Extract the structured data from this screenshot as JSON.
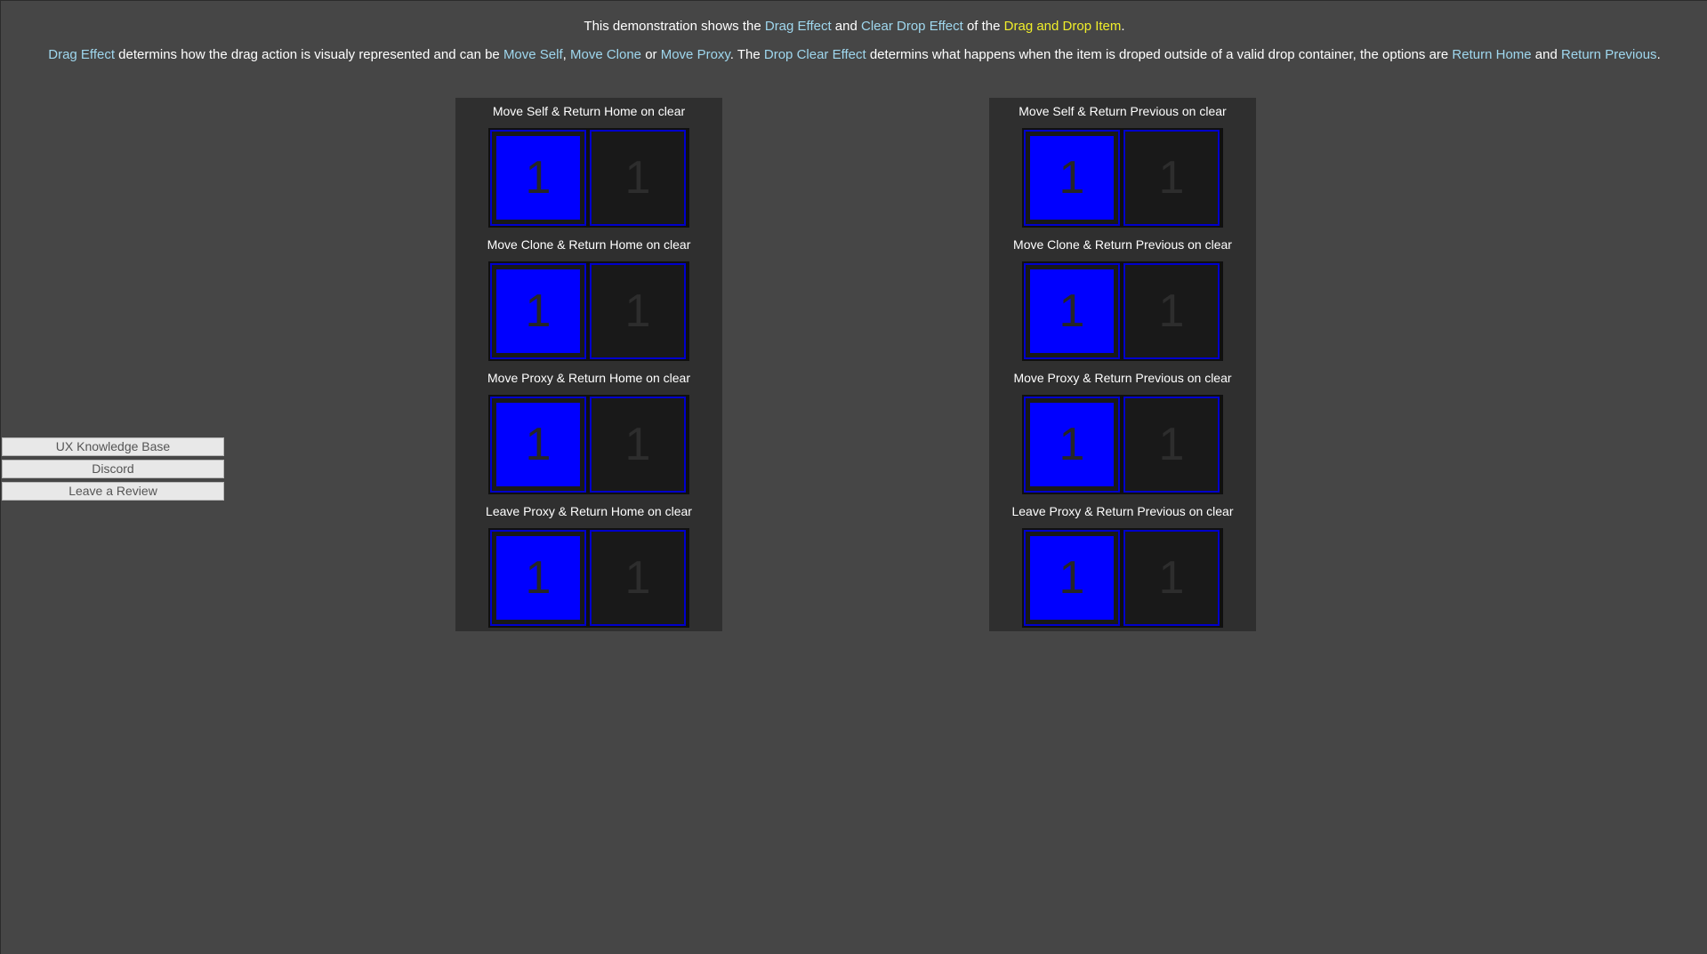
{
  "intro": {
    "line1": [
      {
        "text": "This demonstration shows the ",
        "style": "plain"
      },
      {
        "text": "Drag Effect",
        "style": "hl"
      },
      {
        "text": " and ",
        "style": "plain"
      },
      {
        "text": "Clear Drop Effect",
        "style": "hl"
      },
      {
        "text": " of the ",
        "style": "plain"
      },
      {
        "text": "Drag and Drop Item",
        "style": "hly"
      },
      {
        "text": ".",
        "style": "plain"
      }
    ],
    "line2": [
      {
        "text": "Drag Effect",
        "style": "hl"
      },
      {
        "text": " determins how the drag action is visualy represented and can be ",
        "style": "plain"
      },
      {
        "text": "Move Self",
        "style": "hl"
      },
      {
        "text": ", ",
        "style": "plain"
      },
      {
        "text": "Move Clone",
        "style": "hl"
      },
      {
        "text": " or ",
        "style": "plain"
      },
      {
        "text": "Move Proxy",
        "style": "hl"
      },
      {
        "text": ". The ",
        "style": "plain"
      },
      {
        "text": "Drop Clear Effect",
        "style": "hl"
      },
      {
        "text": " determins what happens when the item is droped outside of a valid drop container, the options are ",
        "style": "plain"
      },
      {
        "text": "Return Home",
        "style": "hl"
      },
      {
        "text": " and ",
        "style": "plain"
      },
      {
        "text": "Return Previous",
        "style": "hl"
      },
      {
        "text": ".",
        "style": "plain"
      }
    ]
  },
  "side_links": [
    {
      "label": "UX Knowledge Base"
    },
    {
      "label": "Discord"
    },
    {
      "label": "Leave a Review"
    }
  ],
  "panels": [
    {
      "demos": [
        {
          "title": "Move Self & Return Home on clear",
          "item_label": "1",
          "empty_slot_label": "1"
        },
        {
          "title": "Move Clone & Return Home on clear",
          "item_label": "1",
          "empty_slot_label": "1"
        },
        {
          "title": "Move Proxy & Return Home on clear",
          "item_label": "1",
          "empty_slot_label": "1"
        },
        {
          "title": "Leave Proxy & Return Home on clear",
          "item_label": "1",
          "empty_slot_label": "1"
        }
      ]
    },
    {
      "demos": [
        {
          "title": "Move Self & Return Previous on clear",
          "item_label": "1",
          "empty_slot_label": "1"
        },
        {
          "title": "Move Clone & Return Previous on clear",
          "item_label": "1",
          "empty_slot_label": "1"
        },
        {
          "title": "Move Proxy & Return Previous on clear",
          "item_label": "1",
          "empty_slot_label": "1"
        },
        {
          "title": "Leave Proxy & Return Previous on clear",
          "item_label": "1",
          "empty_slot_label": "1"
        }
      ]
    }
  ],
  "colors": {
    "background": "#464646",
    "panel": "#2f2f2f",
    "slot_border": "#0000cc",
    "item": "#0000ff",
    "highlight": "#9fd7ee",
    "highlight_yellow": "#f0ee2a"
  }
}
